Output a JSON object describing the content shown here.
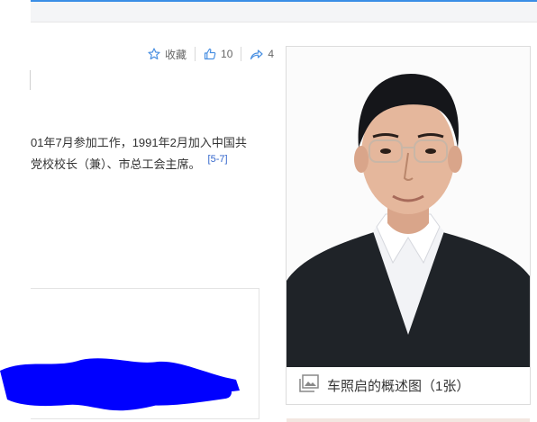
{
  "actions": {
    "favorite": {
      "label": "收藏",
      "icon": "star-icon"
    },
    "like": {
      "count": "10",
      "icon": "thumbs-up-icon"
    },
    "share": {
      "count": "4",
      "icon": "share-icon"
    }
  },
  "article": {
    "line1": "01年7月参加工作，1991年2月加入中国共",
    "line2": "党校校长（兼）、市总工会主席。",
    "ref": "[5-7]"
  },
  "album": {
    "caption": "车照启的概述图（1张）",
    "icon": "image-gallery-icon"
  },
  "colors": {
    "accent": "#3a8ee6",
    "link": "#3366cc",
    "redaction": "#0000ff"
  }
}
